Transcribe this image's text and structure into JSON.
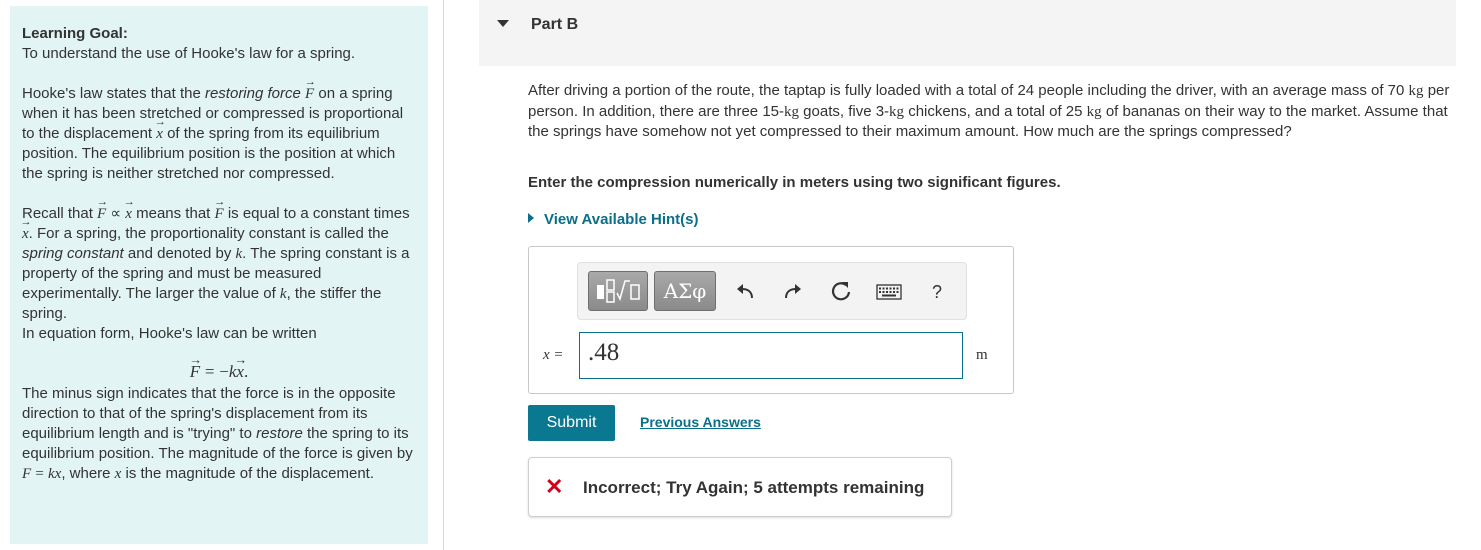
{
  "sidebar": {
    "goal_title": "Learning Goal:",
    "goal_text": "To understand the use of Hooke's law for a spring.",
    "p1_a": "Hooke's law states that the ",
    "p1_em1": "restoring force",
    "p1_b": " on a spring when it has been stretched or compressed is proportional to the displacement ",
    "p1_c": " of the spring from its equilibrium position. The equilibrium position is the position at which the spring is neither stretched nor compressed.",
    "p2_a": "Recall that ",
    "p2_b": " means that ",
    "p2_c": " is equal to a constant times ",
    "p2_d": ". For a spring, the proportionality constant is called the ",
    "p2_em": "spring constant",
    "p2_e": " and denoted by ",
    "p2_f": ". The spring constant is a property of the spring and must be measured experimentally. The larger the value of ",
    "p2_g": ", the stiffer the spring.",
    "p3": "In equation form, Hooke's law can be written",
    "p4_a": "The minus sign indicates that the force is in the opposite direction to that of the spring's displacement from its equilibrium length and is \"trying\" to ",
    "p4_em": "restore",
    "p4_b": " the spring to its equilibrium position. The magnitude of the force is given by ",
    "p4_c": ", where ",
    "p4_d": " is the magnitude of the displacement."
  },
  "part": {
    "title": "Part B"
  },
  "question": {
    "a": "After driving a portion of the route, the taptap is fully loaded with a total of 24 people including the driver, with an average mass of 70 ",
    "unit_kg": "kg",
    "b": " per person. In addition, there are three 15-",
    "c": " goats, five 3-",
    "d": " chickens, and a total of 25 ",
    "e": " of bananas on their way to the market. Assume that the springs have somehow not yet compressed to their maximum amount. How much are the springs compressed?",
    "instruction": "Enter the compression numerically in meters using two significant figures.",
    "hints_label": "View Available Hint(s)"
  },
  "answer": {
    "var_label": "x =",
    "value": ".48",
    "unit": "m",
    "symbols_label": "ΑΣφ",
    "help_label": "?"
  },
  "actions": {
    "submit_label": "Submit",
    "previous_answers_label": "Previous Answers"
  },
  "feedback": {
    "text": "Incorrect; Try Again; 5 attempts remaining",
    "color": "#d0021b"
  },
  "colors": {
    "sidebar_bg": "#e3f4f5",
    "accent": "#0b7891",
    "link": "#0b6f8a"
  }
}
